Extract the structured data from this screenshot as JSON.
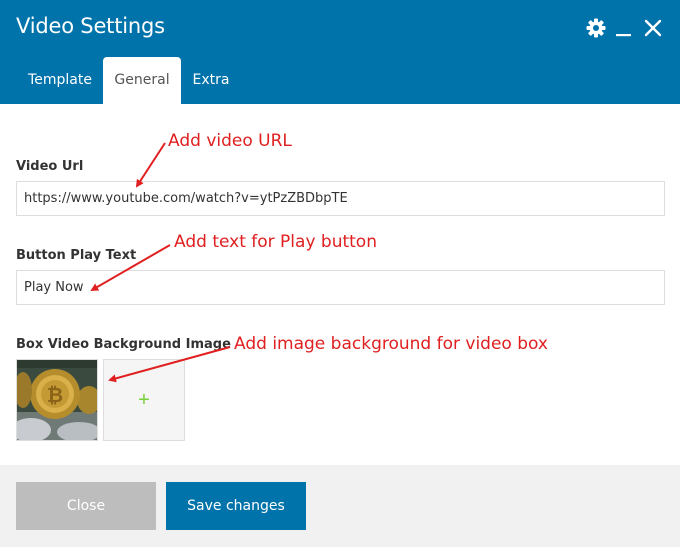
{
  "dialog": {
    "title": "Video Settings"
  },
  "header_icons": [
    "gear-icon",
    "minimize-icon",
    "close-icon"
  ],
  "tabs": [
    {
      "label": "Template",
      "active": false
    },
    {
      "label": "General",
      "active": true
    },
    {
      "label": "Extra",
      "active": false
    }
  ],
  "fields": {
    "video_url": {
      "label": "Video Url",
      "value": "https://www.youtube.com/watch?v=ytPzZBDbpTE"
    },
    "button_play_text": {
      "label": "Button Play Text",
      "value": "Play Now"
    },
    "background_image": {
      "label": "Box Video Background Image",
      "add_symbol": "+"
    }
  },
  "annotations": {
    "video_url": "Add video URL",
    "play_text": "Add text for Play button",
    "background": "Add image background for video box"
  },
  "footer": {
    "close_label": "Close",
    "save_label": "Save changes"
  },
  "colors": {
    "header": "#0073aa",
    "annotation": "#e02020",
    "save_button": "#0073aa",
    "close_button": "#bdbdbd",
    "add_plus": "#7ad03a"
  }
}
